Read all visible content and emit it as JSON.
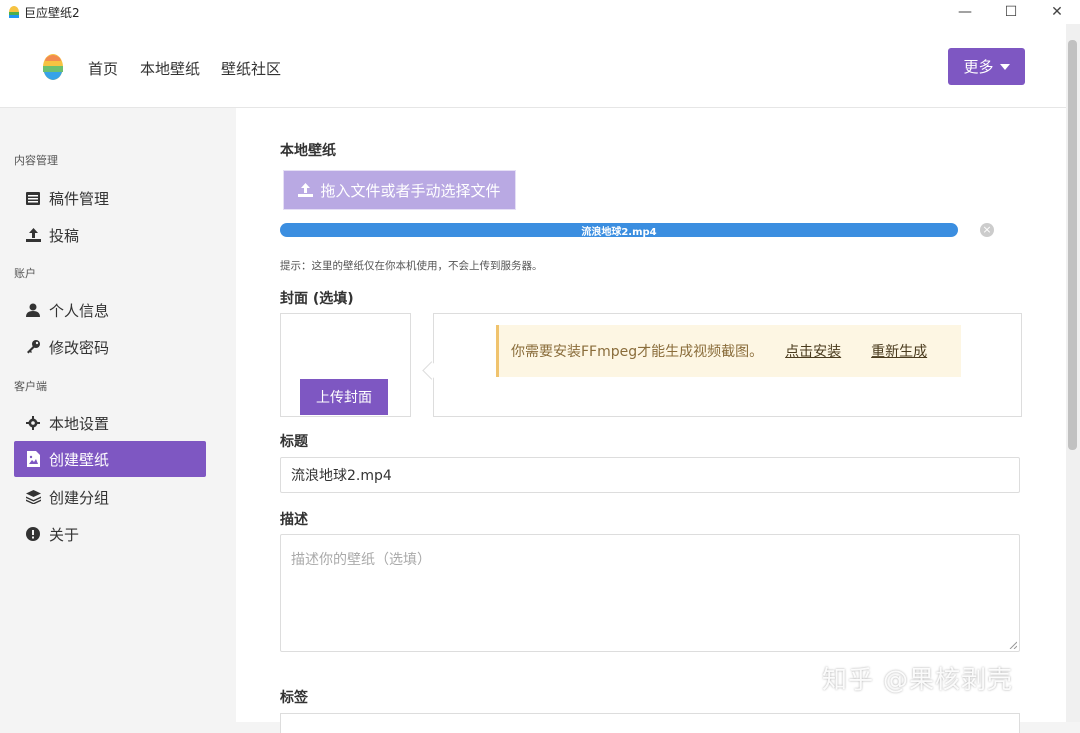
{
  "window": {
    "title": "巨应壁纸2",
    "controls": {
      "minimize": "—",
      "maximize": "☐",
      "close": "✕"
    }
  },
  "nav": {
    "items": [
      "首页",
      "本地壁纸",
      "壁纸社区"
    ],
    "more_label": "更多"
  },
  "sidebar": {
    "sections": [
      {
        "title": "内容管理",
        "items": [
          {
            "label": "稿件管理",
            "icon": "list-icon"
          },
          {
            "label": "投稿",
            "icon": "upload-icon"
          }
        ]
      },
      {
        "title": "账户",
        "items": [
          {
            "label": "个人信息",
            "icon": "user-icon"
          },
          {
            "label": "修改密码",
            "icon": "key-icon"
          }
        ]
      },
      {
        "title": "客户端",
        "items": [
          {
            "label": "本地设置",
            "icon": "gear-icon"
          },
          {
            "label": "创建壁纸",
            "icon": "file-image-icon",
            "active": true
          },
          {
            "label": "创建分组",
            "icon": "layers-icon"
          },
          {
            "label": "关于",
            "icon": "info-icon"
          }
        ]
      }
    ]
  },
  "form": {
    "local_wallpaper_label": "本地壁纸",
    "upload_button": "拖入文件或者手动选择文件",
    "progress_file": "流浪地球2.mp4",
    "progress_percent": 100,
    "hint": "提示：这里的壁纸仅在你本机使用，不会上传到服务器。",
    "cover_label": "封面 (选填)",
    "upload_cover": "上传封面",
    "warning_text": "你需要安装FFmpeg才能生成视频截图。",
    "warning_link_install": "点击安装",
    "warning_link_regenerate": "重新生成",
    "title_label": "标题",
    "title_value": "流浪地球2.mp4",
    "desc_label": "描述",
    "desc_placeholder": "描述你的壁纸（选填）",
    "tags_label": "标签"
  },
  "watermark": "知乎 @果核剥壳",
  "colors": {
    "accent": "#7e57c2",
    "progress": "#3b8ee0",
    "warning_bg": "#fdf6e3"
  }
}
